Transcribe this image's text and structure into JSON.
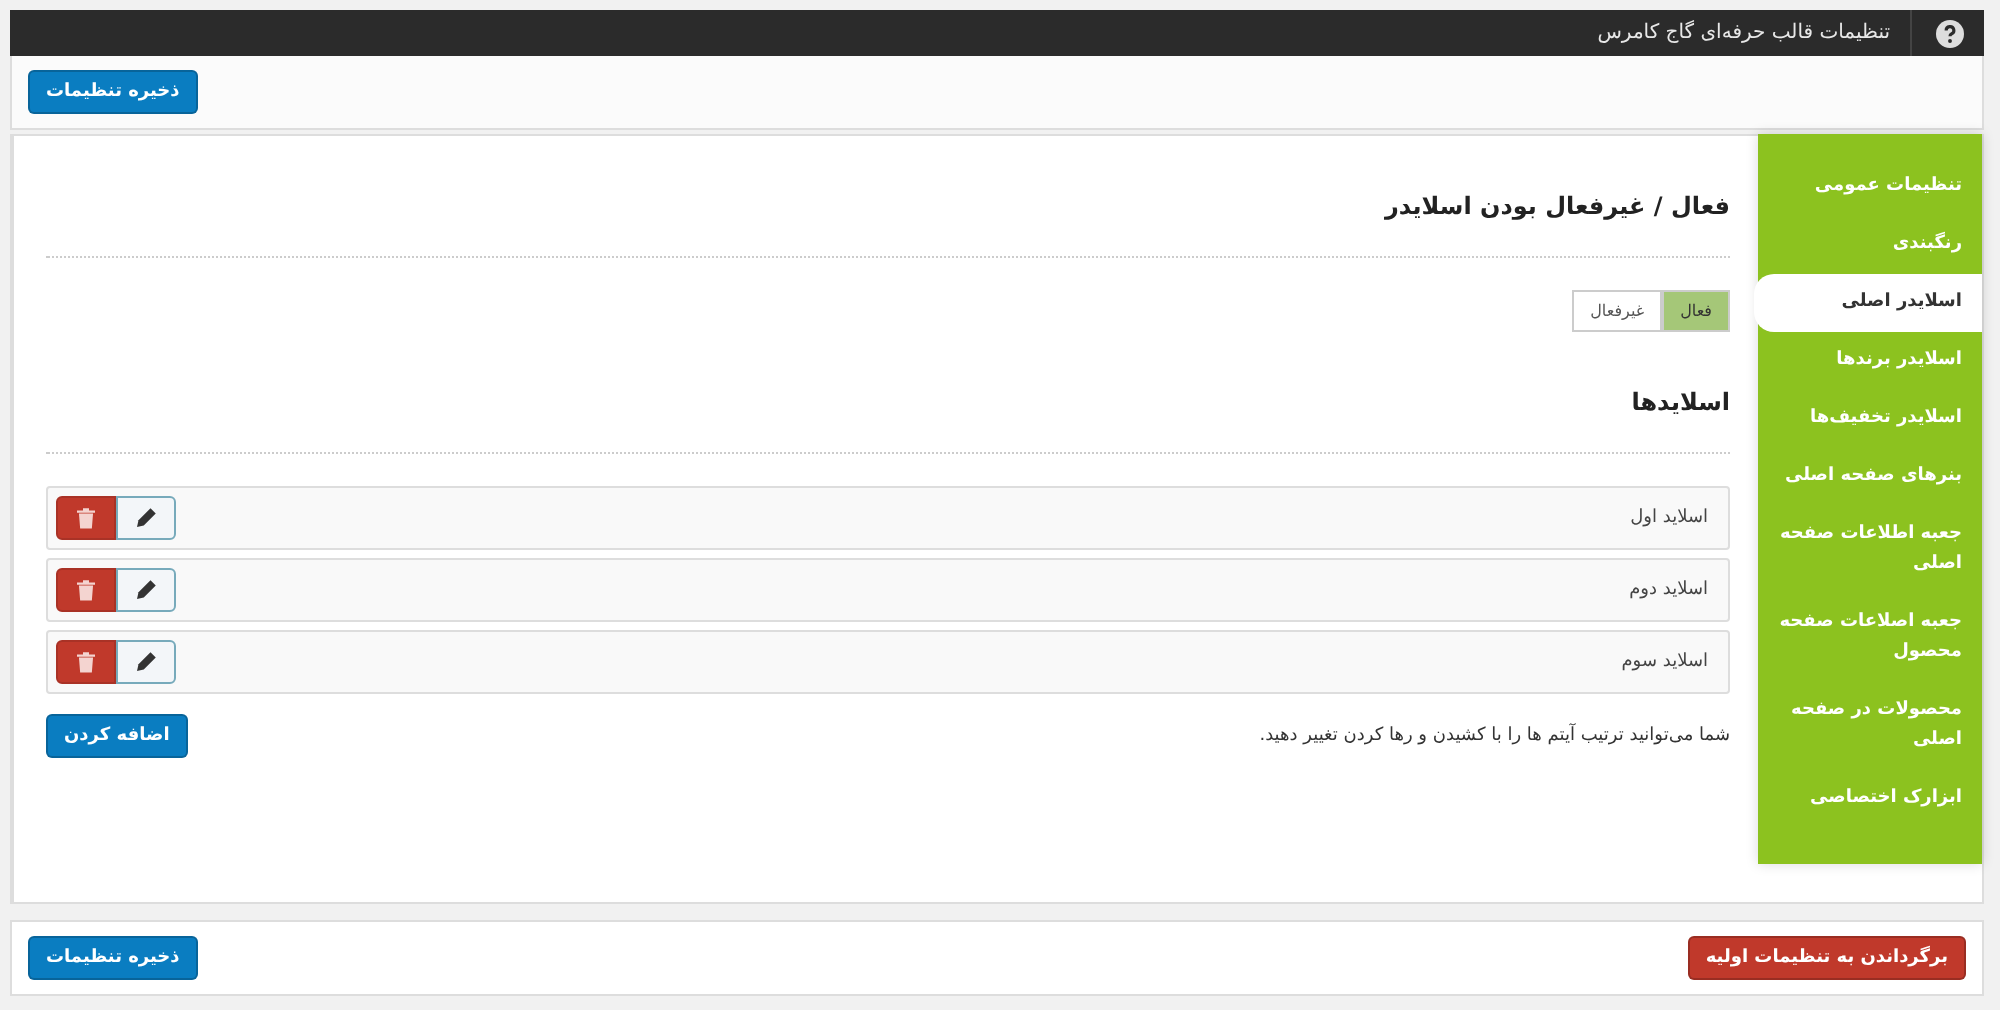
{
  "topbar": {
    "title": "تنظیمات قالب حرفه‌ای گاج کامرس"
  },
  "header": {
    "save_button": "ذخیره تنظیمات"
  },
  "sidebar": {
    "items": [
      {
        "label": "تنظیمات عمومی",
        "selected": false
      },
      {
        "label": "رنگبندی",
        "selected": false
      },
      {
        "label": "اسلایدر اصلی",
        "selected": true
      },
      {
        "label": "اسلایدر برندها",
        "selected": false
      },
      {
        "label": "اسلایدر تخفیف‌ها",
        "selected": false
      },
      {
        "label": "بنرهای صفحه اصلی",
        "selected": false
      },
      {
        "label": "جعبه اطلاعات صفحه اصلی",
        "selected": false
      },
      {
        "label": "جعبه اصلاعات صفحه محصول",
        "selected": false
      },
      {
        "label": "محصولات در صفحه اصلی",
        "selected": false
      },
      {
        "label": "ابزارک اختصاصی",
        "selected": false
      }
    ]
  },
  "section1": {
    "title": "فعال / غیرفعال بودن اسلایدر",
    "toggle": [
      {
        "label": "فعال",
        "selected": true
      },
      {
        "label": "غیرفعال",
        "selected": false
      }
    ]
  },
  "section2": {
    "title": "اسلایدها",
    "slides": [
      {
        "label": "اسلاید اول"
      },
      {
        "label": "اسلاید دوم"
      },
      {
        "label": "اسلاید سوم"
      }
    ],
    "hint": "شما می‌توانید ترتیب آیتم ها را با کشیدن و رها کردن تغییر دهید.",
    "add_button": "اضافه کردن"
  },
  "footer": {
    "reset_button": "برگرداندن به تنظیمات اولیه",
    "save_button": "ذخیره تنظیمات"
  }
}
